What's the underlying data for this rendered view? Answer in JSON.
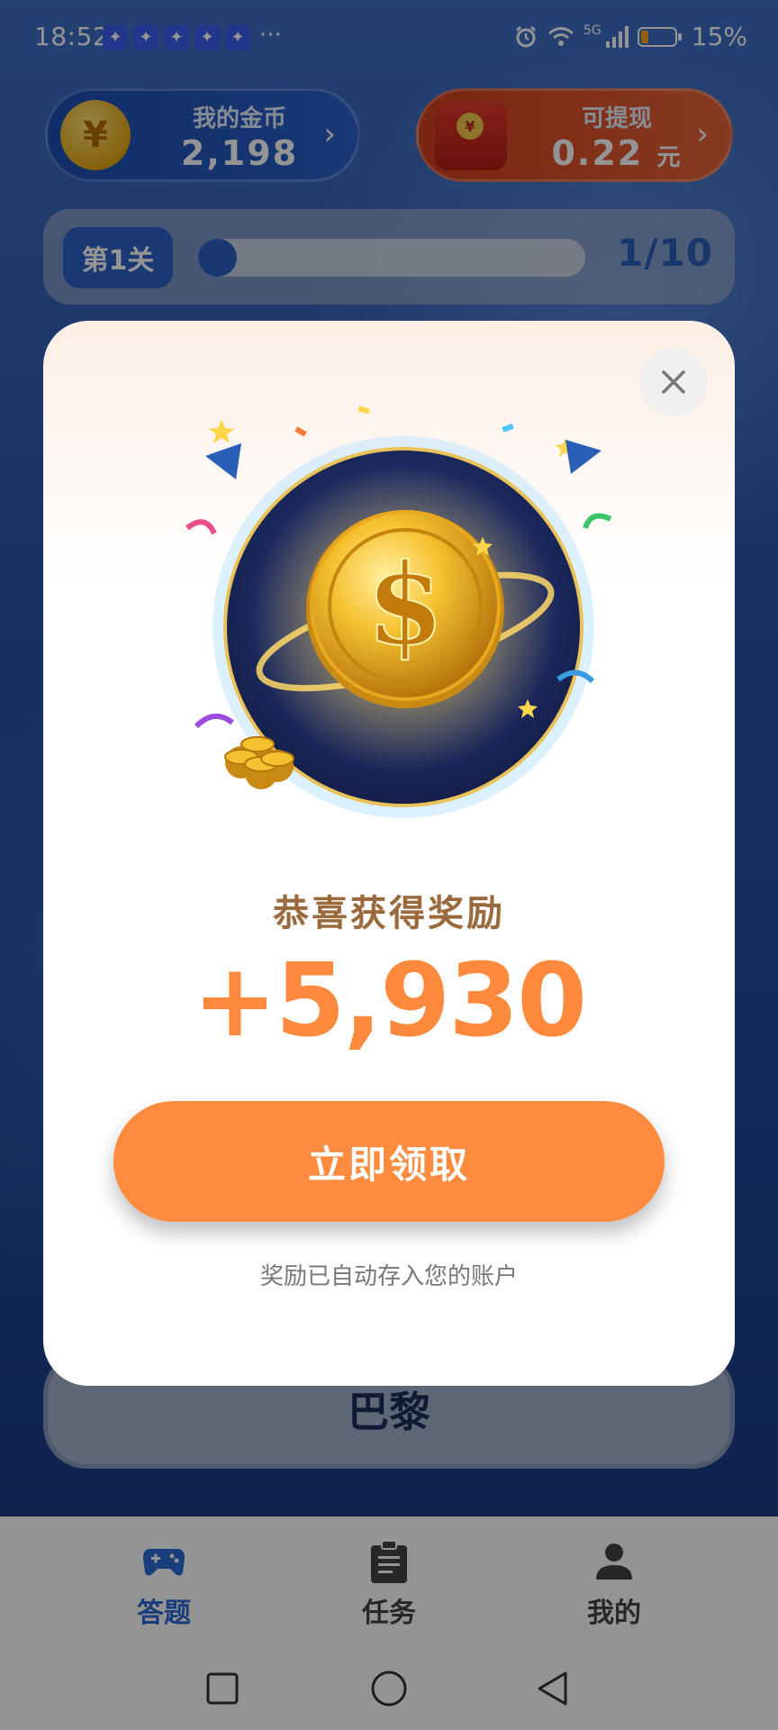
{
  "status_bar": {
    "time": "18:52",
    "more": "···",
    "network": "5G",
    "battery": "15%",
    "notification_icon": "app-notification-icon"
  },
  "header": {
    "coins_label": "我的金币",
    "coins_value": "2,198",
    "cash_label": "可提现",
    "cash_value": "0.22",
    "cash_unit": "元",
    "coin_symbol": "¥"
  },
  "level": {
    "label": "第1关",
    "progress_text": "1/10",
    "progress_fraction": 0.1
  },
  "answer_option": "巴黎",
  "modal": {
    "title": "恭喜获得奖励",
    "amount": "+5,930",
    "claim_button": "立即领取",
    "note": "奖励已自动存入您的账户"
  },
  "bottom_nav": [
    {
      "label": "答题",
      "icon": "gamepad-icon",
      "active": true
    },
    {
      "label": "任务",
      "icon": "clipboard-icon",
      "active": false
    },
    {
      "label": "我的",
      "icon": "user-icon",
      "active": false
    }
  ],
  "colors": {
    "accent_orange": "#ff8b3f",
    "nav_active": "#2d6ad6",
    "title_brown": "#9a6a3c"
  }
}
